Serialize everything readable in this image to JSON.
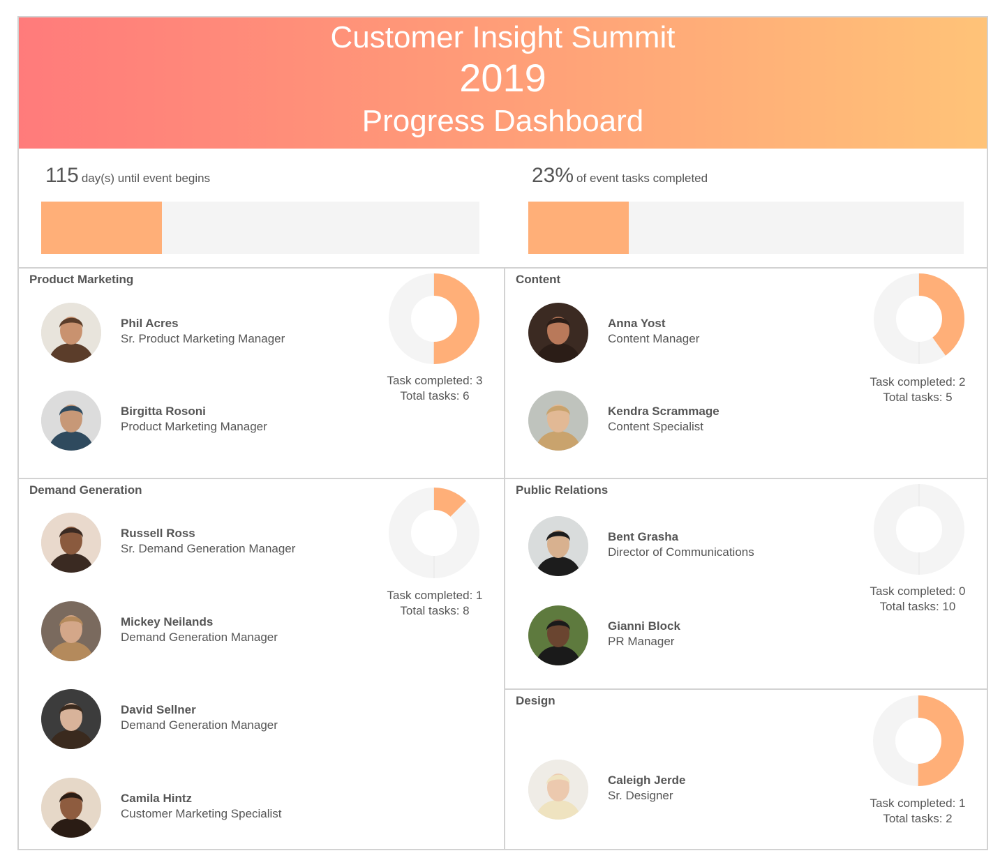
{
  "header": {
    "line1": "Customer Insight Summit",
    "line2": "2019",
    "line3": "Progress Dashboard"
  },
  "kpis": {
    "days": {
      "value": "115",
      "label": "day(s) until event begins",
      "progress": 0.275
    },
    "tasks": {
      "value": "23%",
      "label": "of event tasks completed",
      "progress": 0.23
    }
  },
  "colors": {
    "accent": "#ffaf78",
    "track": "#f4f4f4",
    "border": "#d2d2d2",
    "text": "#555555"
  },
  "labels": {
    "completed": "Task completed:",
    "total": "Total tasks:"
  },
  "teams": [
    {
      "name": "Product Marketing",
      "completed": 3,
      "total": 6,
      "members": [
        {
          "name": "Phil Acres",
          "role": "Sr. Product Marketing Manager",
          "icon": "avatar-photo"
        },
        {
          "name": "Birgitta Rosoni",
          "role": "Product Marketing Manager",
          "icon": "avatar-photo"
        }
      ]
    },
    {
      "name": "Content",
      "completed": 2,
      "total": 5,
      "members": [
        {
          "name": "Anna Yost",
          "role": "Content Manager",
          "icon": "avatar-photo"
        },
        {
          "name": "Kendra Scrammage",
          "role": "Content Specialist",
          "icon": "avatar-photo"
        }
      ]
    },
    {
      "name": "Demand Generation",
      "completed": 1,
      "total": 8,
      "members": [
        {
          "name": "Russell Ross",
          "role": "Sr. Demand Generation Manager",
          "icon": "avatar-photo"
        },
        {
          "name": "Mickey Neilands",
          "role": "Demand Generation Manager",
          "icon": "avatar-photo"
        },
        {
          "name": "David Sellner",
          "role": "Demand Generation Manager",
          "icon": "avatar-photo"
        },
        {
          "name": "Camila Hintz",
          "role": "Customer Marketing Specialist",
          "icon": "avatar-photo"
        }
      ]
    },
    {
      "name": "Public Relations",
      "completed": 0,
      "total": 10,
      "members": [
        {
          "name": "Bent Grasha",
          "role": "Director of Communications",
          "icon": "avatar-photo"
        },
        {
          "name": "Gianni Block",
          "role": "PR Manager",
          "icon": "avatar-photo"
        }
      ]
    },
    {
      "name": "Design",
      "completed": 1,
      "total": 2,
      "members": [
        {
          "name": "Caleigh Jerde",
          "role": "Sr. Designer",
          "icon": "avatar-photo"
        }
      ]
    }
  ]
}
